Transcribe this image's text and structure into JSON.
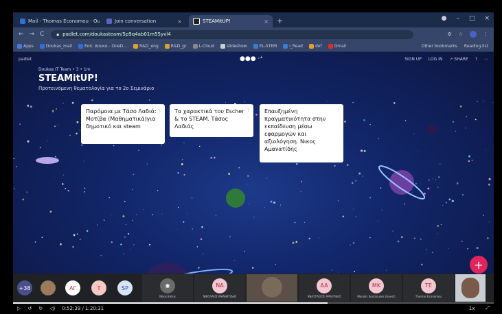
{
  "browser": {
    "tabs": [
      {
        "label": "Mail - Thomas Economou - Outl",
        "color": "#2f6fd6"
      },
      {
        "label": "Join conversation",
        "color": "#5a62c4"
      },
      {
        "label": "STEAMitUP!",
        "color": "#222222"
      }
    ],
    "url": "padlet.com/doukasteam/5p9q4ab01m55yvl4",
    "bookmarks": [
      {
        "label": "Apps",
        "color": "#4f76d9"
      },
      {
        "label": "Doukas_mail",
        "color": "#2f6fd6"
      },
      {
        "label": "Εκπ. Δουκα - OneD...",
        "color": "#2f6fd6"
      },
      {
        "label": "R&D_eng",
        "color": "#e0a030"
      },
      {
        "label": "R&D_gr",
        "color": "#e0a030"
      },
      {
        "label": "L-Cloud",
        "color": "#888888"
      },
      {
        "label": "slideshow",
        "color": "#cccccc"
      },
      {
        "label": "EL-STEM",
        "color": "#3a7bd5"
      },
      {
        "label": "i_Read",
        "color": "#3a7bd5"
      },
      {
        "label": "def",
        "color": "#e0a030"
      },
      {
        "label": "Gmail",
        "color": "#d93025"
      }
    ],
    "bookmarks_right": [
      "Other bookmarks",
      "Reading list"
    ]
  },
  "padlet": {
    "brand": "padlet",
    "nav": [
      "SIGN UP",
      "LOG IN",
      "SHARE"
    ],
    "meta": "Doukas IT Team • 3 • 1m",
    "title": "STEAMitUP!",
    "subtitle": "Προτεινόμενη θεματολογία για το 2ο Σεμινάριο",
    "cards": [
      {
        "text": "Παρόμοια με Τάσο Λαδιά: Μοτίβα (Μαθηματικά)για δημοτικό και steam"
      },
      {
        "text": "Τα χαρακτικά του Escher & το STEAM. Τάσος Λαδιάς"
      },
      {
        "text": "Επαυξημένη πραγματικότητα στην εκπαίδευση μέσω εφαρμογών και αξιολόγηση. Νικος Αμανατίδης"
      }
    ],
    "fab": "+"
  },
  "meeting": {
    "more_count": "+38",
    "initials": [
      {
        "text": "ΑΓ",
        "color": "#ffffff",
        "fg": "#c0392b"
      },
      {
        "text": "Τ",
        "color": "#f6c9c4",
        "fg": "#c0392b"
      },
      {
        "text": "SP",
        "color": "#d6e4f5",
        "fg": "#1a4a8a"
      }
    ],
    "tiles": [
      {
        "initials": "",
        "name": "Nikos Kotsis",
        "color": "#6b6b6b"
      },
      {
        "initials": "NA",
        "name": "ΝΙΚΟΛΑΟΣ ΑΜΑΝΑΤΙΔΗΣ",
        "color": "#f3c6d0"
      },
      {
        "initials": "",
        "name": "",
        "color": "#7a6a5c"
      },
      {
        "initials": "AA",
        "name": "ΑΝΑΣΤΑΣΙΟΣ ΑΡΚΑΤΙΚΑΣ",
        "color": "#f3c6d0"
      },
      {
        "initials": "MK",
        "name": "Manolis Koutsoukos (Guest)",
        "color": "#f3c6d0"
      },
      {
        "initials": "TE",
        "name": "Thomas Economou",
        "color": "#f3c6d0"
      }
    ]
  },
  "player": {
    "time": "0:52:39 / 1:20:31",
    "progress": 0.654,
    "speed": "1x"
  }
}
